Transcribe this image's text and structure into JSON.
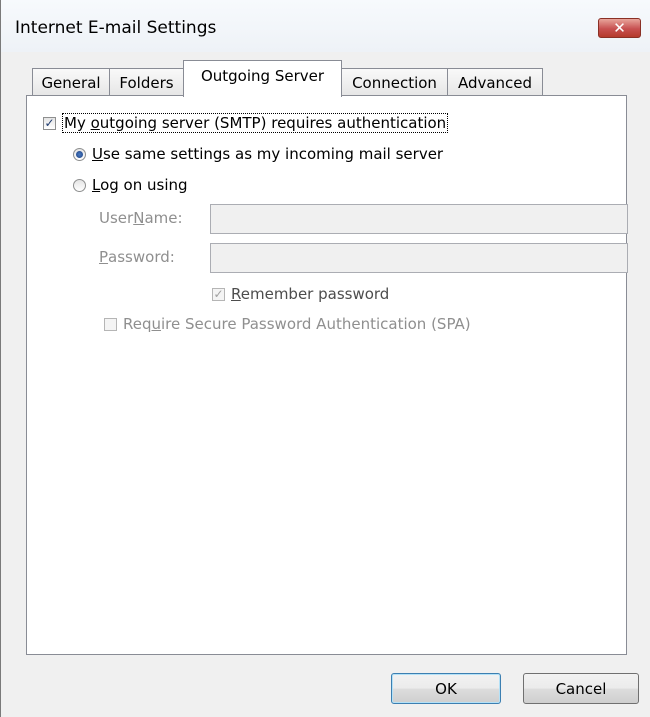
{
  "window": {
    "title": "Internet E-mail Settings",
    "close_glyph": "✕"
  },
  "tabs": [
    {
      "label": "General"
    },
    {
      "label": "Folders"
    },
    {
      "label": "Outgoing Server",
      "active": true
    },
    {
      "label": "Connection"
    },
    {
      "label": "Advanced"
    }
  ],
  "auth": {
    "checkbox_label_pre": "My ",
    "checkbox_label_access": "o",
    "checkbox_label_post": "utgoing server (SMTP) requires authentication",
    "checked": true,
    "same_settings_access": "U",
    "same_settings_rest": "se same settings as my incoming mail server",
    "same_settings_selected": true,
    "logon_access": "L",
    "logon_rest": "og on using",
    "logon_selected": false
  },
  "credentials": {
    "username_pre": "User ",
    "username_access": "N",
    "username_post": "ame:",
    "username_value": "",
    "password_access": "P",
    "password_post": "assword:",
    "password_value": "",
    "remember_access": "R",
    "remember_rest": "emember password",
    "remember_checked": true,
    "spa_pre": "Req",
    "spa_access": "u",
    "spa_post": "ire Secure Password Authentication (SPA)",
    "spa_checked": false
  },
  "buttons": {
    "ok": "OK",
    "cancel": "Cancel"
  },
  "glyphs": {
    "check": "✓"
  },
  "colors": {
    "accent": "#3c7fb1",
    "close": "#c75050",
    "disabled_text": "#8f8f8f"
  }
}
